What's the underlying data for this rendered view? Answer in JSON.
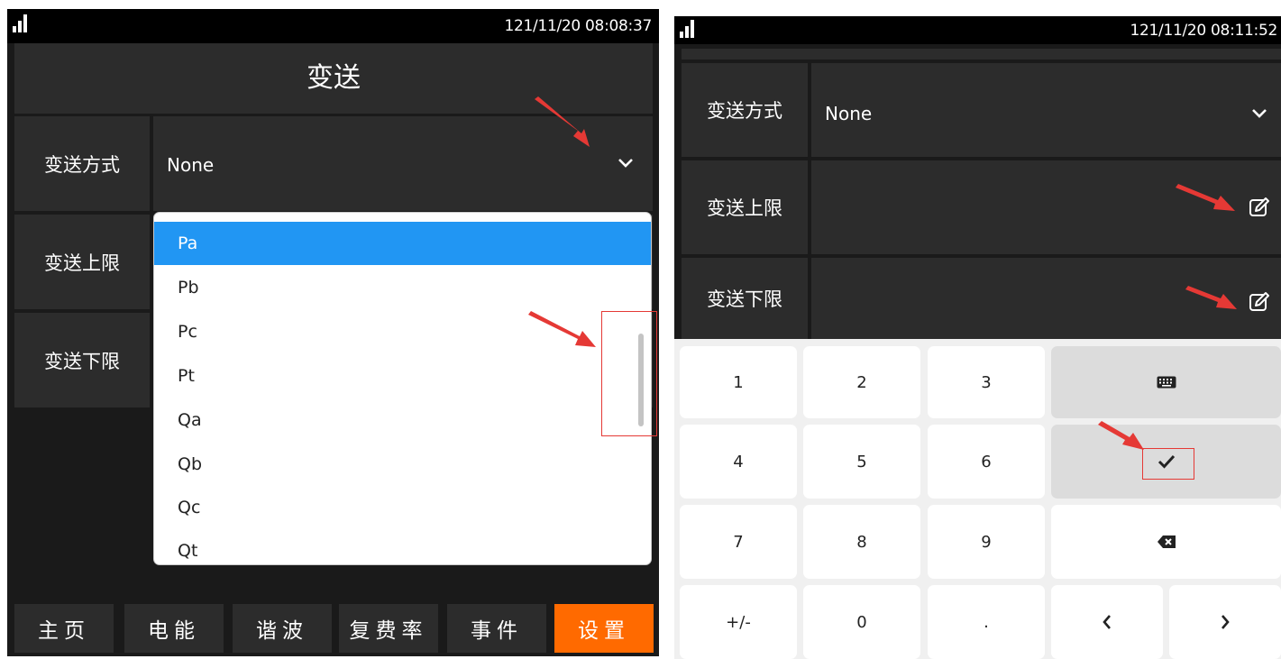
{
  "left_screen": {
    "status": {
      "time": "121/11/20 08:08:37"
    },
    "title": "变送",
    "rows": [
      {
        "label": "变送方式",
        "value": "None"
      },
      {
        "label": "变送上限"
      },
      {
        "label": "变送下限"
      }
    ],
    "dropdown_options": [
      "Pa",
      "Pb",
      "Pc",
      "Pt",
      "Qa",
      "Qb",
      "Qc",
      "Qt"
    ],
    "dropdown_selected": "Pa",
    "tabs": [
      {
        "label": "主页",
        "active": false
      },
      {
        "label": "电能",
        "active": false
      },
      {
        "label": "谐波",
        "active": false
      },
      {
        "label": "复费率",
        "active": false
      },
      {
        "label": "事件",
        "active": false
      },
      {
        "label": "设置",
        "active": true
      }
    ]
  },
  "right_screen": {
    "status": {
      "time": "121/11/20 08:11:52"
    },
    "rows": [
      {
        "label": "变送方式",
        "value": "None"
      },
      {
        "label": "变送上限"
      },
      {
        "label": "变送下限"
      }
    ],
    "keypad": {
      "row1": [
        "1",
        "2",
        "3"
      ],
      "row2": [
        "4",
        "5",
        "6"
      ],
      "row3": [
        "7",
        "8",
        "9"
      ],
      "row4": [
        "+/-",
        "0",
        "."
      ]
    },
    "icons": {
      "keyboard": "keyboard-icon",
      "confirm": "check-icon",
      "backspace": "backspace-icon",
      "left": "chevron-left-icon",
      "right": "chevron-right-icon"
    }
  },
  "colors": {
    "background": "#1a1a1a",
    "cell": "#2c2c2c",
    "active_tab": "#ff6a00",
    "selected_option": "#2196f3",
    "annotation": "#e53935"
  }
}
